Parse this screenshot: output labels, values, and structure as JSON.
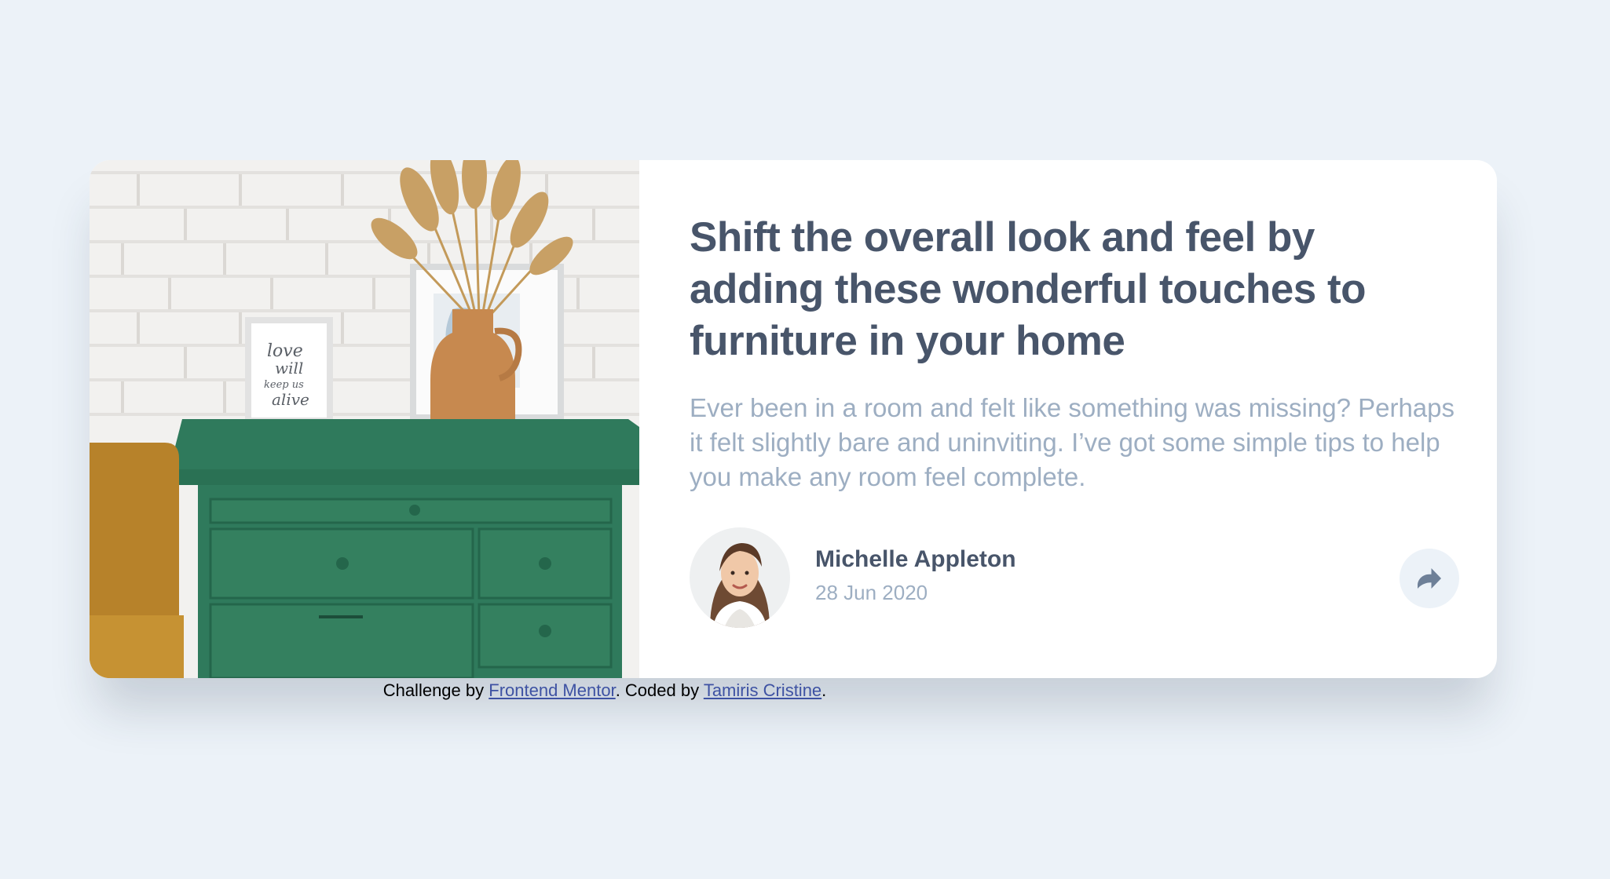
{
  "card": {
    "image_alt": "Green drawers with a vase of dried grass and framed prints against a white brick wall",
    "title": "Shift the overall look and feel by adding these wonderful touches to furniture in your home",
    "description": "Ever been in a room and felt like something was missing? Perhaps it felt slightly bare and uninviting. I’ve got some simple tips to help you make any room feel complete.",
    "author": {
      "name": "Michelle Appleton",
      "date": "28 Jun 2020",
      "avatar_alt": "Michelle Appleton"
    },
    "share": {
      "aria_label": "Share",
      "icon": "share-icon"
    }
  },
  "attribution": {
    "prefix": "Challenge by ",
    "link1_text": "Frontend Mentor",
    "middle": ". Coded by ",
    "link2_text": "Tamiris Cristine",
    "suffix": "."
  },
  "colors": {
    "background": "#ecf2f8",
    "card": "#ffffff",
    "title": "#48556a",
    "muted": "#9daec2",
    "share_bg": "#ecf2f8",
    "share_icon": "#6e8098",
    "link": "#3e52a3"
  }
}
